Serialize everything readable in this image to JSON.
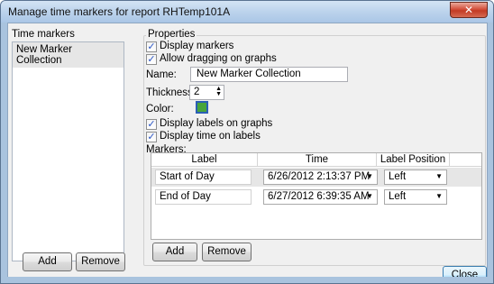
{
  "window": {
    "title": "Manage time markers for report RHTemp101A",
    "close_glyph": "✕"
  },
  "left": {
    "title": "Time markers",
    "items": [
      "New Marker Collection"
    ],
    "add_label": "Add",
    "remove_label": "Remove"
  },
  "properties": {
    "title": "Properties",
    "display_markers": {
      "label": "Display markers",
      "checked": true
    },
    "allow_dragging": {
      "label": "Allow dragging on graphs",
      "checked": true
    },
    "name_label": "Name:",
    "name_value": "New Marker Collection",
    "thickness_label": "Thickness:",
    "thickness_value": "2",
    "color_label": "Color:",
    "color_value": "#48a53c",
    "display_labels": {
      "label": "Display labels on graphs",
      "checked": true
    },
    "display_time": {
      "label": "Display time on labels",
      "checked": true
    },
    "markers_label": "Markers:"
  },
  "markers": {
    "columns": [
      "Label",
      "Time",
      "Label Position"
    ],
    "rows": [
      {
        "label": "Start of Day",
        "time": "6/26/2012 2:13:37 PM",
        "position": "Left"
      },
      {
        "label": "End of Day",
        "time": "6/27/2012 6:39:35 AM",
        "position": "Left"
      }
    ],
    "add_label": "Add",
    "remove_label": "Remove"
  },
  "footer": {
    "close_label": "Close"
  },
  "check_glyph": "✓",
  "dropdown_glyph": "▼",
  "spin_up_glyph": "▲",
  "spin_down_glyph": "▼"
}
